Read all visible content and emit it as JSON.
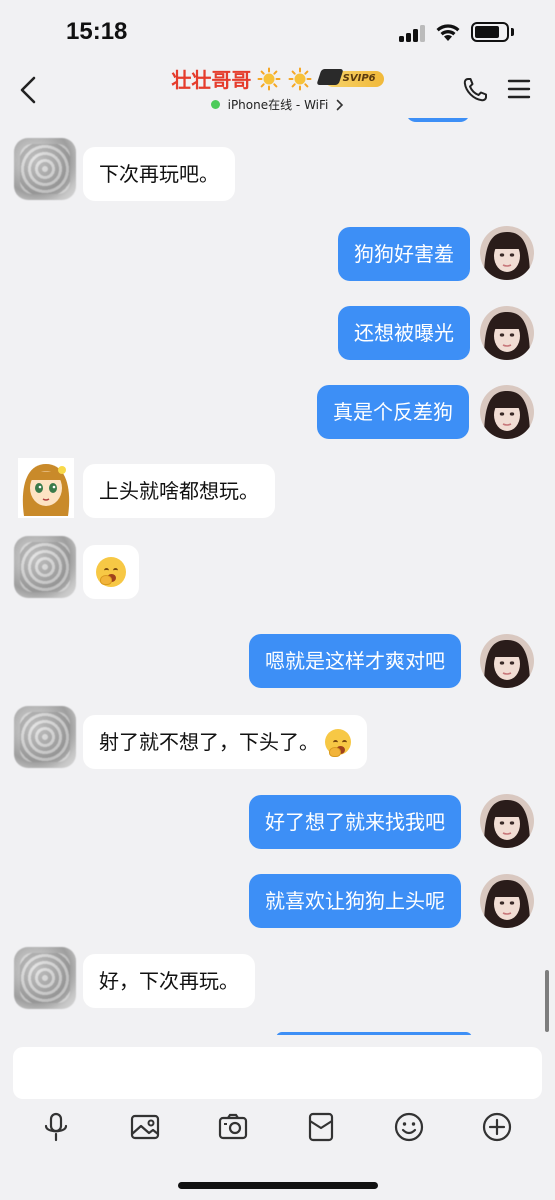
{
  "status_bar": {
    "time": "15:18"
  },
  "header": {
    "contact_name": "壮壮哥哥",
    "vip_badge": "SVIP6",
    "status_text": "iPhone在线 - WiFi",
    "accent_color": "#e53c2c",
    "online_color": "#4dcb5a"
  },
  "messages": [
    {
      "side": "in",
      "text": "下次再玩吧。"
    },
    {
      "side": "out",
      "text": "狗狗好害羞"
    },
    {
      "side": "out",
      "text": "还想被曝光"
    },
    {
      "side": "out",
      "text": "真是个反差狗"
    },
    {
      "side": "in",
      "text": "上头就啥都想玩。"
    },
    {
      "side": "in",
      "text": "",
      "emoji": "yawn-emoji"
    },
    {
      "side": "out",
      "text": "嗯就是这样才爽对吧"
    },
    {
      "side": "in",
      "text": "射了就不想了，下头了。",
      "emoji": "yawn-emoji"
    },
    {
      "side": "out",
      "text": "好了想了就来找我吧"
    },
    {
      "side": "out",
      "text": "就喜欢让狗狗上头呢"
    },
    {
      "side": "in",
      "text": "好，下次再玩。"
    }
  ],
  "input": {
    "placeholder": "",
    "value": ""
  },
  "toolbar": {
    "icons": [
      "microphone-icon",
      "image-icon",
      "camera-icon",
      "red-packet-icon",
      "smiley-icon",
      "plus-icon"
    ]
  },
  "colors": {
    "outgoing_bubble": "#3d8ff6",
    "incoming_bubble": "#ffffff",
    "background": "#f1f1f3"
  }
}
